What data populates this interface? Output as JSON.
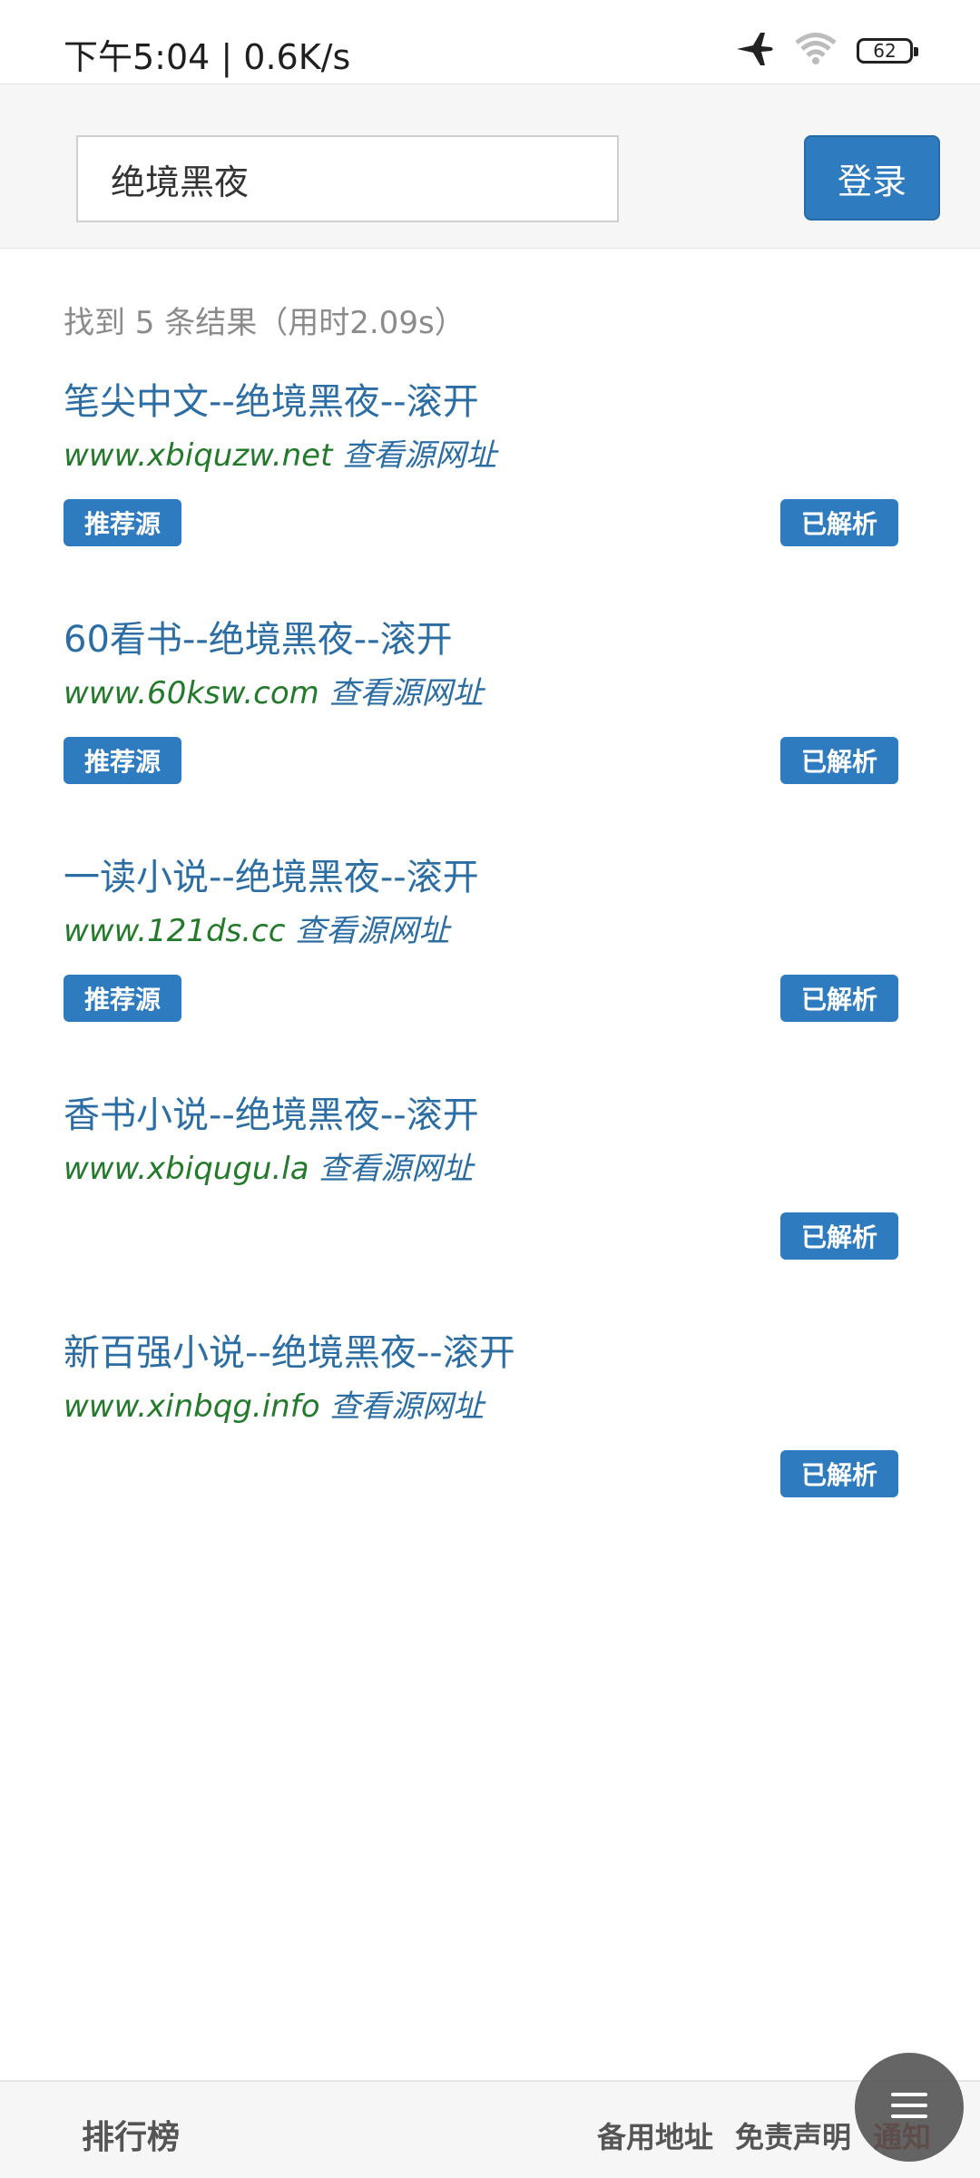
{
  "status_bar": {
    "time_speed": "下午5:04 | 0.6K/s",
    "battery": "62",
    "icons": [
      "airplane-icon",
      "wifi-icon",
      "battery-icon"
    ]
  },
  "search": {
    "query": "绝境黑夜",
    "login_label": "登录"
  },
  "summary": "找到 5 条结果（用时2.09s）",
  "results": [
    {
      "title": "笔尖中文--绝境黑夜--滚开",
      "url": "www.xbiquzw.net",
      "view": "查看源网址",
      "recommend": "推荐源",
      "parsed": "已解析"
    },
    {
      "title": "60看书--绝境黑夜--滚开",
      "url": "www.60ksw.com",
      "view": "查看源网址",
      "recommend": "推荐源",
      "parsed": "已解析"
    },
    {
      "title": "一读小说--绝境黑夜--滚开",
      "url": "www.121ds.cc",
      "view": "查看源网址",
      "recommend": "推荐源",
      "parsed": "已解析"
    },
    {
      "title": "香书小说--绝境黑夜--滚开",
      "url": "www.xbiqugu.la",
      "view": "查看源网址",
      "parsed": "已解析"
    },
    {
      "title": "新百强小说--绝境黑夜--滚开",
      "url": "www.xinbqg.info",
      "view": "查看源网址",
      "parsed": "已解析"
    }
  ],
  "bottom": {
    "rank": "排行榜",
    "backup": "备用地址",
    "disclaimer": "免责声明",
    "notice": "通知"
  },
  "colors": {
    "accent": "#2f7bbf",
    "link": "#2c6ea3",
    "url_green": "#237a2b"
  }
}
